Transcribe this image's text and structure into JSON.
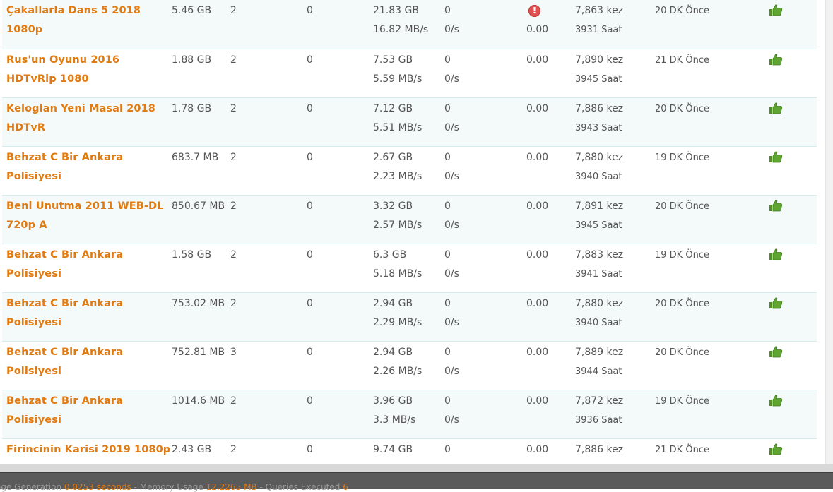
{
  "rows": [
    {
      "name": "Çakallarla Dans 5 2018 1080p",
      "size": "5.46 GB",
      "seeders": "2",
      "leechers": "0",
      "total": "21.83 GB",
      "speed": "16.82 MB/s",
      "col7a": "0",
      "col7b": "0/s",
      "ratio": "0.00",
      "has_warning": true,
      "hits": "7,863 kez",
      "hours": "3931 Saat",
      "added": "20 DK Önce"
    },
    {
      "name": "Rus'un Oyunu 2016 HDTvRip 1080",
      "size": "1.88 GB",
      "seeders": "2",
      "leechers": "0",
      "total": "7.53 GB",
      "speed": "5.59 MB/s",
      "col7a": "0",
      "col7b": "0/s",
      "ratio": "0.00",
      "has_warning": false,
      "hits": "7,890 kez",
      "hours": "3945 Saat",
      "added": "21 DK Önce"
    },
    {
      "name": "Keloglan Yeni Masal 2018 HDTvR",
      "size": "1.78 GB",
      "seeders": "2",
      "leechers": "0",
      "total": "7.12 GB",
      "speed": "5.51 MB/s",
      "col7a": "0",
      "col7b": "0/s",
      "ratio": "0.00",
      "has_warning": false,
      "hits": "7,886 kez",
      "hours": "3943 Saat",
      "added": "20 DK Önce"
    },
    {
      "name": "Behzat C Bir Ankara Polisiyesi",
      "size": "683.7 MB",
      "seeders": "2",
      "leechers": "0",
      "total": "2.67 GB",
      "speed": "2.23 MB/s",
      "col7a": "0",
      "col7b": "0/s",
      "ratio": "0.00",
      "has_warning": false,
      "hits": "7,880 kez",
      "hours": "3940 Saat",
      "added": "19 DK Önce"
    },
    {
      "name": "Beni Unutma 2011 WEB-DL 720p A",
      "size": "850.67 MB",
      "seeders": "2",
      "leechers": "0",
      "total": "3.32 GB",
      "speed": "2.57 MB/s",
      "col7a": "0",
      "col7b": "0/s",
      "ratio": "0.00",
      "has_warning": false,
      "hits": "7,891 kez",
      "hours": "3945 Saat",
      "added": "20 DK Önce"
    },
    {
      "name": "Behzat C Bir Ankara Polisiyesi",
      "size": "1.58 GB",
      "seeders": "2",
      "leechers": "0",
      "total": "6.3 GB",
      "speed": "5.18 MB/s",
      "col7a": "0",
      "col7b": "0/s",
      "ratio": "0.00",
      "has_warning": false,
      "hits": "7,883 kez",
      "hours": "3941 Saat",
      "added": "19 DK Önce"
    },
    {
      "name": "Behzat C Bir Ankara Polisiyesi",
      "size": "753.02 MB",
      "seeders": "2",
      "leechers": "0",
      "total": "2.94 GB",
      "speed": "2.29 MB/s",
      "col7a": "0",
      "col7b": "0/s",
      "ratio": "0.00",
      "has_warning": false,
      "hits": "7,880 kez",
      "hours": "3940 Saat",
      "added": "20 DK Önce"
    },
    {
      "name": "Behzat C Bir Ankara Polisiyesi",
      "size": "752.81 MB",
      "seeders": "3",
      "leechers": "0",
      "total": "2.94 GB",
      "speed": "2.26 MB/s",
      "col7a": "0",
      "col7b": "0/s",
      "ratio": "0.00",
      "has_warning": false,
      "hits": "7,889 kez",
      "hours": "3944 Saat",
      "added": "20 DK Önce"
    },
    {
      "name": "Behzat C Bir Ankara Polisiyesi",
      "size": "1014.6 MB",
      "seeders": "2",
      "leechers": "0",
      "total": "3.96 GB",
      "speed": "3.3 MB/s",
      "col7a": "0",
      "col7b": "0/s",
      "ratio": "0.00",
      "has_warning": false,
      "hits": "7,872 kez",
      "hours": "3936 Saat",
      "added": "19 DK Önce"
    },
    {
      "name": "Firincinin Karisi 2019 1080p",
      "size": "2.43 GB",
      "seeders": "2",
      "leechers": "0",
      "total": "9.74 GB",
      "speed": "",
      "col7a": "0",
      "col7b": "",
      "ratio": "0.00",
      "has_warning": false,
      "hits": "7,886 kez",
      "hours": "",
      "added": "21 DK Önce"
    }
  ],
  "icons": {
    "warning": "exclamation-circle-icon",
    "thanks": "thumbs-up-icon"
  },
  "warning_glyph": "!",
  "colors": {
    "link": "#e07a12",
    "ratio": "#d40000",
    "thumb": "#5a9e2e",
    "warning": "#e05050"
  },
  "footer": {
    "gen_label": "age Generation",
    "gen_value": "0.0253 seconds",
    "sep1": " - ",
    "mem_label": "Memory Usage",
    "mem_value": "12.2265 MB",
    "sep2": " - ",
    "q_label": "Queries Executed",
    "q_value": "6"
  }
}
